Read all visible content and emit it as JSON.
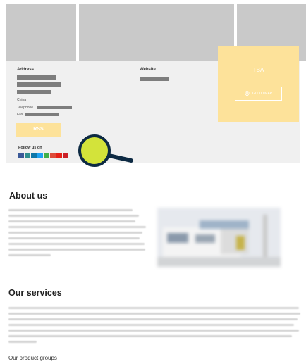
{
  "contact": {
    "address_label": "Address",
    "country": "China",
    "telephone_label": "Telephone",
    "fax_label": "Fax",
    "website_label": "Website",
    "rss_label": "RSS",
    "follow_label": "Follow us on"
  },
  "promo": {
    "title": "TBA",
    "map_button": "GO TO MAP"
  },
  "social_icons": [
    {
      "name": "facebook-icon",
      "color": "#3b5998"
    },
    {
      "name": "xing-icon",
      "color": "#2f8f8f"
    },
    {
      "name": "linkedin-icon",
      "color": "#0e76a8"
    },
    {
      "name": "twitter-icon",
      "color": "#1da1f2"
    },
    {
      "name": "wechat-icon",
      "color": "#3fb049"
    },
    {
      "name": "google-plus-icon",
      "color": "#dd4b39"
    },
    {
      "name": "youtube-icon",
      "color": "#e62117"
    },
    {
      "name": "pinterest-icon",
      "color": "#cb2027"
    }
  ],
  "about": {
    "title": "About us"
  },
  "services": {
    "title": "Our services",
    "product_groups": "Our product groups"
  },
  "colors": {
    "accent_yellow": "#fde29a",
    "magnifier_fill": "#d3e33a",
    "magnifier_ring": "#0d2a43"
  }
}
